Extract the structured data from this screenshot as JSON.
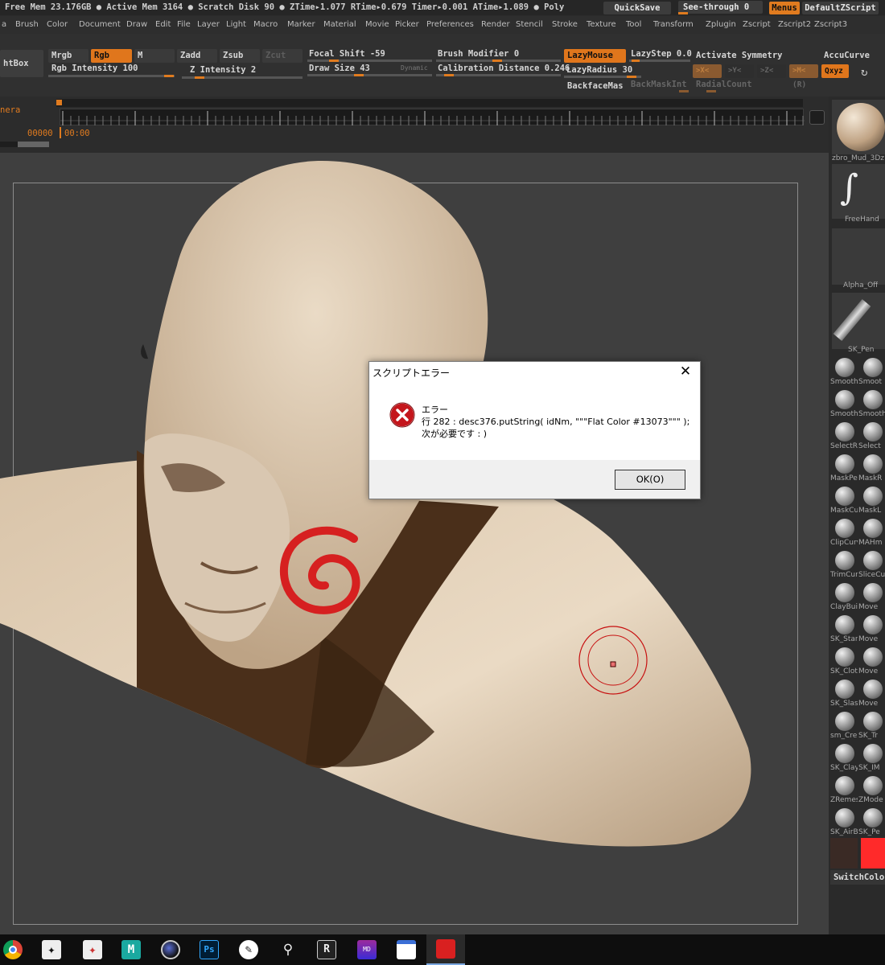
{
  "status": {
    "text": "Free Mem 23.176GB ● Active Mem 3164 ● Scratch Disk 90 ●  ZTime▸1.077 RTime▸0.679 Timer▸0.001 ATime▸1.089 ● Poly",
    "quicksave": "QuickSave",
    "see_through": "See-through  0",
    "menus": "Menus",
    "default_zscript": "DefaultZScript"
  },
  "menubar": {
    "items": [
      "a",
      "Brush",
      "Color",
      "Document",
      "Draw",
      "Edit",
      "File",
      "Layer",
      "Light",
      "Macro",
      "Marker",
      "Material",
      "Movie",
      "Picker",
      "Preferences",
      "Render",
      "Stencil",
      "Stroke",
      "Texture",
      "Tool",
      "Transform",
      "Zplugin",
      "Zscript",
      "Zscript2",
      "Zscript3"
    ]
  },
  "toolbar": {
    "lightbox": "htBox",
    "mrgb": "Mrgb",
    "rgb": "Rgb",
    "m": "M",
    "zadd": "Zadd",
    "zsub": "Zsub",
    "zcut": "Zcut",
    "rgb_intensity": "Rgb Intensity 100",
    "z_intensity": "Z Intensity 2",
    "focal_shift": "Focal Shift -59",
    "draw_size": "Draw Size 43",
    "dynamic": "Dynamic",
    "brush_modifier": "Brush Modifier 0",
    "calibration_distance": "Calibration Distance 0.246",
    "lazymouse": "LazyMouse",
    "lazystep": "LazyStep 0.0",
    "lazyradius": "LazyRadius 30",
    "backfacemask": "BackfaceMas",
    "backmaskint": "BackMaskInt",
    "activate_symmetry": "Activate Symmetry",
    "sym_x": ">X<",
    "sym_y": ">Y<",
    "sym_z": ">Z<",
    "sym_m": ">M<",
    "radialcount": "RadialCount",
    "r": "(R)",
    "accucurve": "AccuCurve",
    "xyz": "Qxyz"
  },
  "timeline": {
    "label": "nera",
    "frame": "00000",
    "time": "00:00"
  },
  "rpanel": {
    "material": "zbro_Mud_3Dz",
    "stroke": "FreeHand",
    "alpha": "Alpha_Off",
    "brush": "SK_Pen",
    "brushes": [
      [
        "SmoothD",
        "Smoot"
      ],
      [
        "Smooth",
        "Smooth"
      ],
      [
        "SelectRe",
        "Select"
      ],
      [
        "MaskPer",
        "MaskR"
      ],
      [
        "MaskCur",
        "MaskL"
      ],
      [
        "ClipCurv",
        "MAHm"
      ],
      [
        "TrimCur",
        "SliceCu"
      ],
      [
        "ClayBuild",
        "Move"
      ],
      [
        "SK_Star",
        "Move"
      ],
      [
        "SK_Clotl",
        "Move"
      ],
      [
        "SK_Slas",
        "Move"
      ],
      [
        "sm_Cre",
        "SK_Tr"
      ],
      [
        "SK_Clay",
        "SK_IM"
      ],
      [
        "ZRemest",
        "ZMode"
      ],
      [
        "SK_AirB",
        "SK_Pe"
      ]
    ],
    "switchcolor": "SwitchColor",
    "colors": {
      "main": "#ff2a2a",
      "secondary": "#3a2a25"
    }
  },
  "dialog": {
    "title": "スクリプトエラー",
    "close": "✕",
    "heading": "エラー",
    "line1": "行 282 : desc376.putString( idNm, \"\"\"Flat Color #13073\"\"\" );",
    "line2": "次が必要です : )",
    "ok": "OK(O)"
  },
  "taskbar": {
    "icons": [
      "chrome-icon",
      "zbrush-icon",
      "zbrush-core-icon",
      "maya-icon",
      "cinema4d-icon",
      "photoshop-icon",
      "clip-studio-icon",
      "search-app-icon",
      "rizom-icon",
      "marvelous-icon",
      "window-icon",
      "ztoolbox-icon"
    ]
  },
  "colors": {
    "accent": "#e07b1f",
    "skin": "#d8c2a8",
    "paint": "#d62020"
  }
}
